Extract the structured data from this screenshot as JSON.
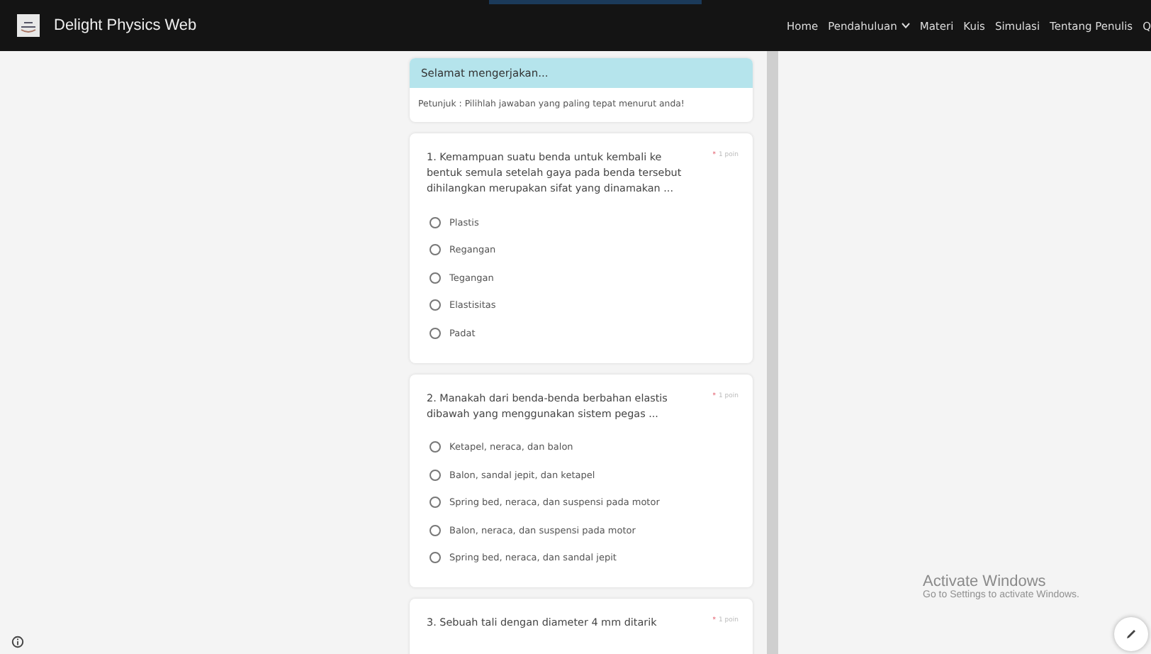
{
  "navbar": {
    "brand": "Delight Physics Web",
    "links": [
      {
        "label": "Home",
        "dropdown": false
      },
      {
        "label": "Pendahuluan",
        "dropdown": true
      },
      {
        "label": "Materi",
        "dropdown": false
      },
      {
        "label": "Kuis",
        "dropdown": false
      },
      {
        "label": "Simulasi",
        "dropdown": false
      },
      {
        "label": "Tentang Penulis",
        "dropdown": false
      },
      {
        "label": "Q",
        "dropdown": false
      }
    ]
  },
  "form_header": {
    "title": "Selamat mengerjakan...",
    "instructions": "Petunjuk : Pilihlah jawaban yang paling tepat menurut anda!"
  },
  "questions": [
    {
      "text": "1. Kemampuan suatu benda untuk kembali ke bentuk semula setelah gaya pada benda tersebut dihilangkan merupakan sifat yang dinamakan ...",
      "required_mark": "*",
      "points": "1 poin",
      "options": [
        {
          "label": "Plastis",
          "selected": false
        },
        {
          "label": "Regangan",
          "selected": false
        },
        {
          "label": "Tegangan",
          "selected": false
        },
        {
          "label": "Elastisitas",
          "selected": false
        },
        {
          "label": "Padat",
          "selected": false
        }
      ]
    },
    {
      "text": "2. Manakah dari benda-benda berbahan elastis dibawah yang menggunakan sistem pegas ...",
      "required_mark": "*",
      "points": "1 poin",
      "options": [
        {
          "label": "Ketapel, neraca, dan balon",
          "selected": false
        },
        {
          "label": "Balon, sandal jepit, dan ketapel",
          "selected": false
        },
        {
          "label": "Spring bed, neraca, dan suspensi pada motor",
          "selected": false
        },
        {
          "label": "Balon, neraca, dan suspensi pada motor",
          "selected": false
        },
        {
          "label": "Spring bed, neraca, dan sandal jepit",
          "selected": false
        }
      ]
    },
    {
      "text": "3. Sebuah tali dengan diameter 4 mm ditarik",
      "required_mark": "*",
      "points": "1 poin"
    }
  ],
  "watermark_notice": {
    "title": "Activate Windows",
    "subtitle": "Go to Settings to activate Windows."
  }
}
